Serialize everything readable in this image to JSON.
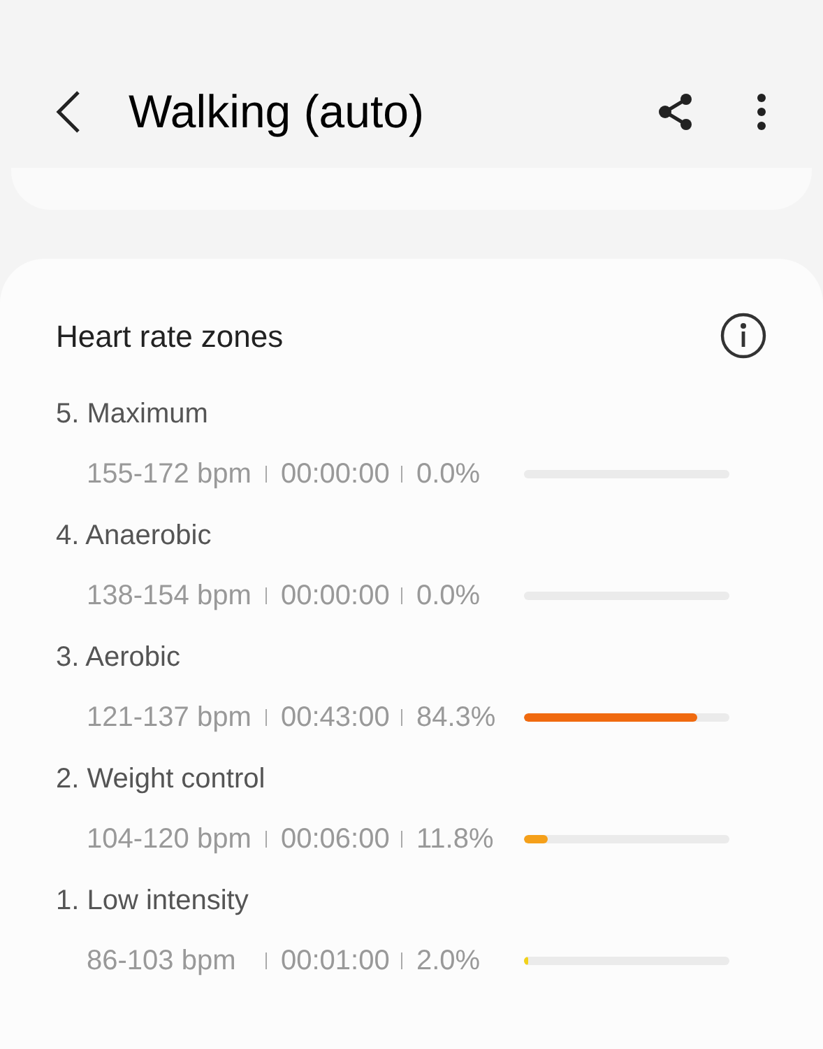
{
  "header": {
    "title": "Walking (auto)"
  },
  "card": {
    "title": "Heart rate zones"
  },
  "zones": [
    {
      "name": "5. Maximum",
      "range": "155-172 bpm",
      "time": "00:00:00",
      "percent": "0.0%"
    },
    {
      "name": "4. Anaerobic",
      "range": "138-154 bpm",
      "time": "00:00:00",
      "percent": "0.0%"
    },
    {
      "name": "3. Aerobic",
      "range": "121-137 bpm",
      "time": "00:43:00",
      "percent": "84.3%",
      "level": 0.843,
      "color": "#f06a0f"
    },
    {
      "name": "2. Weight control",
      "range": "104-120 bpm",
      "time": "00:06:00",
      "percent": "11.8%",
      "level": 0.118,
      "color": "#f5a01a"
    },
    {
      "name": "1. Low intensity",
      "range": "86-103 bpm",
      "time": "00:01:00",
      "percent": "2.0%",
      "level": 0.02,
      "color": "#f2d21b"
    }
  ]
}
